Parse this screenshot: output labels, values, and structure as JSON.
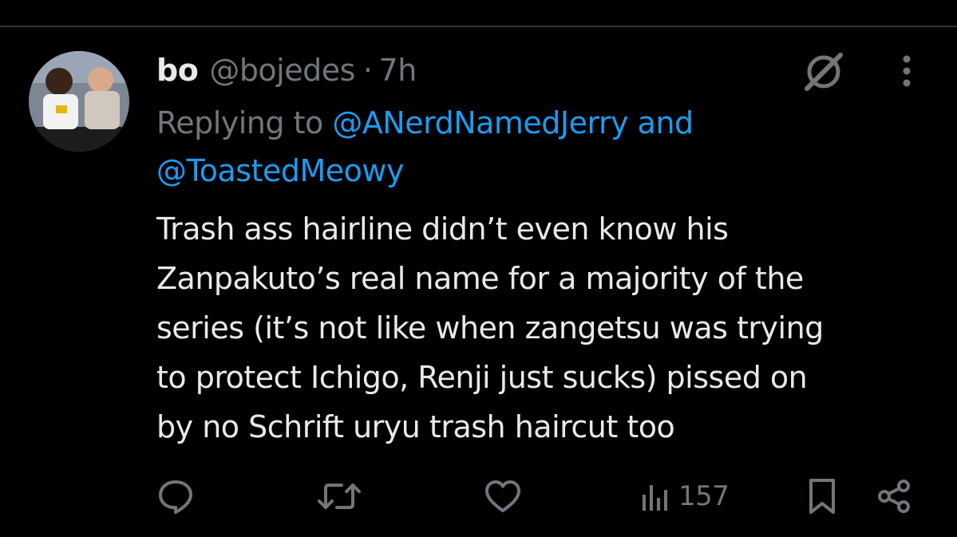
{
  "colors": {
    "background": "#000000",
    "primary_text": "#e7e9ea",
    "secondary_text": "#71767b",
    "accent": "#1d9bf0",
    "divider": "#2f3336"
  },
  "tweet": {
    "display_name": "bo",
    "handle": "@bojedes",
    "separator": "·",
    "time": "7h",
    "reply": {
      "prefix": "Replying to ",
      "mention_1": "@ANerdNamedJerry",
      "connector": " and",
      "mention_2": "@ToastedMeowy"
    },
    "text": "Trash ass hairline didn’t even know his\nZanpakuto’s real name for a majority of the\nseries (it’s not like when zangetsu was trying\nto protect Ichigo, Renji just sucks) pissed on\nby no Schrift uryu trash haircut too",
    "avatar_icon": "profile-photo",
    "header_icons": [
      "grok-icon",
      "more-options-icon"
    ],
    "actions": {
      "reply_icon": "reply-icon",
      "retweet_icon": "retweet-icon",
      "like_icon": "like-icon",
      "views_icon": "views-icon",
      "views_count": "157",
      "bookmark_icon": "bookmark-icon",
      "share_icon": "share-icon"
    }
  }
}
